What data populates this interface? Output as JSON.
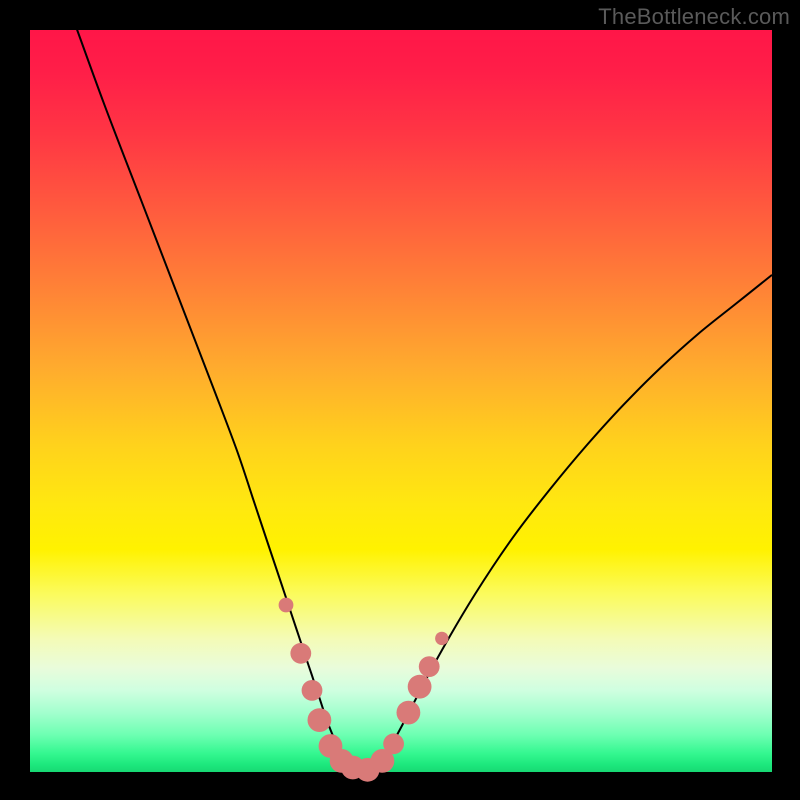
{
  "watermark": "TheBottleneck.com",
  "colors": {
    "frame": "#000000",
    "curve_stroke": "#000000",
    "marker_fill": "#d97a78",
    "gradient_top": "#ff1648",
    "gradient_bottom": "#17d873"
  },
  "chart_data": {
    "type": "line",
    "title": "",
    "xlabel": "",
    "ylabel": "",
    "xlim": [
      0,
      100
    ],
    "ylim": [
      0,
      100
    ],
    "grid": false,
    "legend": false,
    "annotations": [],
    "series": [
      {
        "name": "bottleneck-curve",
        "x": [
          6,
          10,
          15,
          20,
          25,
          28,
          30,
          32,
          34,
          36,
          37,
          38,
          39,
          40,
          41,
          42,
          43,
          44,
          45,
          46,
          48,
          50,
          55,
          60,
          65,
          70,
          75,
          80,
          85,
          90,
          95,
          100
        ],
        "values": [
          101,
          90,
          77,
          64,
          51,
          43,
          37,
          31,
          25,
          19,
          16,
          13,
          10,
          7,
          4.5,
          2.5,
          1.2,
          0.5,
          0.2,
          0.6,
          2.5,
          6,
          15.5,
          24,
          31.5,
          38,
          44,
          49.5,
          54.5,
          59,
          63,
          67
        ]
      }
    ],
    "markers": [
      {
        "x": 34.5,
        "y": 22.5,
        "r": 1.0
      },
      {
        "x": 36.5,
        "y": 16.0,
        "r": 1.4
      },
      {
        "x": 38.0,
        "y": 11.0,
        "r": 1.4
      },
      {
        "x": 39.0,
        "y": 7.0,
        "r": 1.6
      },
      {
        "x": 40.5,
        "y": 3.5,
        "r": 1.6
      },
      {
        "x": 42.0,
        "y": 1.5,
        "r": 1.6
      },
      {
        "x": 43.5,
        "y": 0.6,
        "r": 1.6
      },
      {
        "x": 45.5,
        "y": 0.3,
        "r": 1.6
      },
      {
        "x": 47.5,
        "y": 1.5,
        "r": 1.6
      },
      {
        "x": 49.0,
        "y": 3.8,
        "r": 1.4
      },
      {
        "x": 51.0,
        "y": 8.0,
        "r": 1.6
      },
      {
        "x": 52.5,
        "y": 11.5,
        "r": 1.6
      },
      {
        "x": 53.8,
        "y": 14.2,
        "r": 1.4
      },
      {
        "x": 55.5,
        "y": 18.0,
        "r": 0.9
      }
    ]
  }
}
